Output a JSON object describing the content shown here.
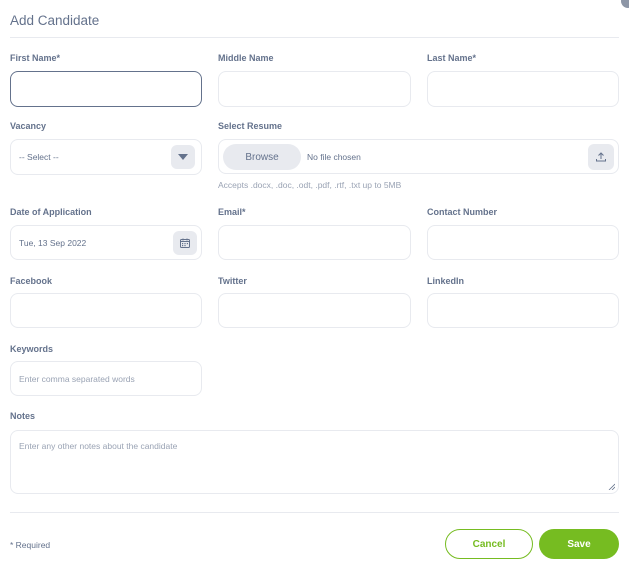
{
  "dialog": {
    "title": "Add Candidate"
  },
  "labels": {
    "first_name": "First Name*",
    "middle_name": "Middle Name",
    "last_name": "Last Name*",
    "vacancy": "Vacancy",
    "select_resume": "Select Resume",
    "date_of_application": "Date of Application",
    "email": "Email*",
    "contact_number": "Contact Number",
    "facebook": "Facebook",
    "twitter": "Twitter",
    "linkedin": "LinkedIn",
    "keywords": "Keywords",
    "notes": "Notes"
  },
  "fields": {
    "first_name": {
      "value": ""
    },
    "middle_name": {
      "value": ""
    },
    "last_name": {
      "value": ""
    },
    "vacancy": {
      "selected": "-- Select --"
    },
    "resume": {
      "browse_label": "Browse",
      "file_status": "No file chosen",
      "hint": "Accepts .docx, .doc, .odt, .pdf, .rtf, .txt up to 5MB"
    },
    "date_of_application": {
      "value": "Tue, 13 Sep 2022"
    },
    "email": {
      "value": ""
    },
    "contact_number": {
      "value": ""
    },
    "facebook": {
      "value": ""
    },
    "twitter": {
      "value": ""
    },
    "linkedin": {
      "value": ""
    },
    "keywords": {
      "placeholder": "Enter comma separated words"
    },
    "notes": {
      "placeholder": "Enter any other notes about the candidate"
    }
  },
  "footer": {
    "required_note": "* Required",
    "cancel_label": "Cancel",
    "save_label": "Save"
  },
  "icons": {
    "vacancy_dropdown": "caret-down-icon",
    "resume_upload": "upload-icon",
    "date_picker": "calendar-icon"
  },
  "colors": {
    "accent": "#76bc21",
    "text": "#64728c",
    "border": "#e8eaef",
    "placeholder": "#9aa3b4"
  }
}
